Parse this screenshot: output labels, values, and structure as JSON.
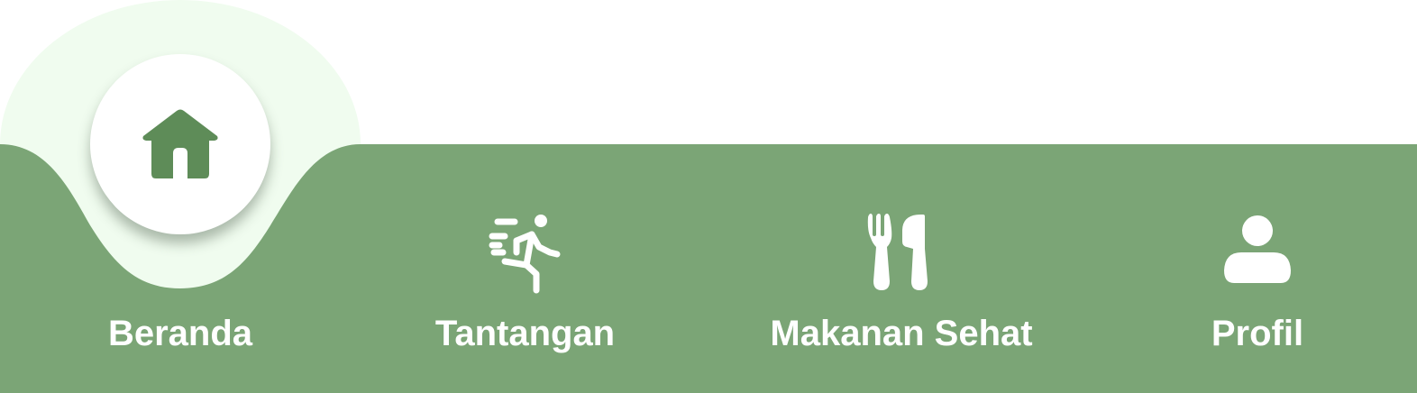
{
  "colors": {
    "nav_background": "#7BA576",
    "active_halo": "#F0FCEF",
    "active_icon": "#5E8C58",
    "icon_and_label": "#FFFFFF"
  },
  "nav": {
    "active_index": 0,
    "items": [
      {
        "label": "Beranda",
        "icon": "home-icon"
      },
      {
        "label": "Tantangan",
        "icon": "running-person-icon"
      },
      {
        "label": "Makanan Sehat",
        "icon": "fork-knife-icon"
      },
      {
        "label": "Profil",
        "icon": "person-icon"
      }
    ]
  }
}
